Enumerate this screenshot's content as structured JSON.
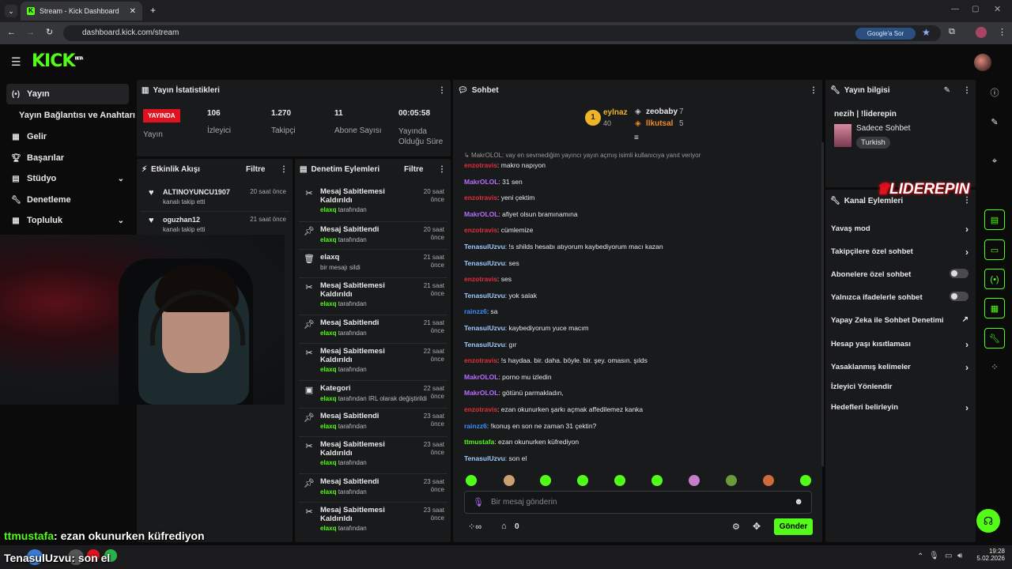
{
  "browser": {
    "tab_title": "Stream - Kick Dashboard",
    "url": "dashboard.kick.com/stream",
    "google_btn": "Google'a Sor"
  },
  "brand": {
    "logo": "KICK",
    "beta": "BETA",
    "accent": "#53fc18"
  },
  "sidebar": {
    "items": [
      {
        "label": "Yayın",
        "icon": "broadcast-icon"
      },
      {
        "label": "Yayın Bağlantısı ve Anahtarı",
        "icon": ""
      },
      {
        "label": "Gelir",
        "icon": "dollar-icon"
      },
      {
        "label": "Başarılar",
        "icon": "trophy-icon"
      },
      {
        "label": "Stüdyo",
        "icon": "studio-icon"
      },
      {
        "label": "Denetleme",
        "icon": "wrench-icon"
      },
      {
        "label": "Topluluk",
        "icon": "community-icon"
      }
    ]
  },
  "stats": {
    "title": "Yayın İstatistikleri",
    "live": "YAYINDA",
    "live_label": "Yayın",
    "items": [
      {
        "value": "106",
        "label": "İzleyici"
      },
      {
        "value": "1.270",
        "label": "Takipçi"
      },
      {
        "value": "11",
        "label": "Abone Sayısı"
      },
      {
        "value": "00:05:58",
        "label": "Yayında Olduğu Süre"
      }
    ]
  },
  "activity": {
    "title": "Etkinlik Akışı",
    "filter": "Filtre",
    "items": [
      {
        "name": "ALTINOYUNCU1907",
        "sub": "kanalı takip etti",
        "time": "20 saat önce"
      },
      {
        "name": "oguzhan12",
        "sub": "kanalı takip etti",
        "time": "21 saat önce"
      }
    ]
  },
  "moderation": {
    "title": "Denetim Eylemleri",
    "filter": "Filtre",
    "items": [
      {
        "icon": "unpin-icon",
        "name": "Mesaj Sabitlemesi Kaldırıldı",
        "user": "elaxq",
        "sub": "tarafından",
        "time": "20 saat önce"
      },
      {
        "icon": "pin-icon",
        "name": "Mesaj Sabitlendi",
        "user": "elaxq",
        "sub": "tarafından",
        "time": "20 saat önce"
      },
      {
        "icon": "trash-icon",
        "name": "elaxq",
        "user": "",
        "sub": "bir mesajı sildi",
        "time": "21 saat önce"
      },
      {
        "icon": "unpin-icon",
        "name": "Mesaj Sabitlemesi Kaldırıldı",
        "user": "elaxq",
        "sub": "tarafından",
        "time": "21 saat önce"
      },
      {
        "icon": "pin-icon",
        "name": "Mesaj Sabitlendi",
        "user": "elaxq",
        "sub": "tarafından",
        "time": "21 saat önce"
      },
      {
        "icon": "unpin-icon",
        "name": "Mesaj Sabitlemesi Kaldırıldı",
        "user": "elaxq",
        "sub": "tarafından",
        "time": "22 saat önce"
      },
      {
        "icon": "category-icon",
        "name": "Kategori",
        "user": "elaxq",
        "sub": "tarafından IRL olarak değiştirildi",
        "time": "22 saat önce"
      },
      {
        "icon": "pin-icon",
        "name": "Mesaj Sabitlendi",
        "user": "elaxq",
        "sub": "tarafından",
        "time": "23 saat önce"
      },
      {
        "icon": "unpin-icon",
        "name": "Mesaj Sabitlemesi Kaldırıldı",
        "user": "elaxq",
        "sub": "tarafından",
        "time": "23 saat önce"
      },
      {
        "icon": "pin-icon",
        "name": "Mesaj Sabitlendi",
        "user": "elaxq",
        "sub": "tarafından",
        "time": "23 saat önce"
      },
      {
        "icon": "unpin-icon",
        "name": "Mesaj Sabitlemesi Kaldırıldı",
        "user": "elaxq",
        "sub": "tarafından",
        "time": "23 saat önce"
      }
    ]
  },
  "chat": {
    "title": "Sohbet",
    "top": [
      {
        "rank": "1",
        "name": "eylnaz",
        "count": "40"
      },
      {
        "name": "zeobaby",
        "count": "7"
      },
      {
        "name": "llkutsal",
        "count": "5"
      }
    ],
    "reply": "MakrOLOL: vay en sevmediğim yayıncı yayın açmış isimli kullanıcıya yanıt veriyor",
    "messages": [
      {
        "user": "enzotravis",
        "color": "#e0303b",
        "text": ": makro napıyon"
      },
      {
        "user": "MakrOLOL",
        "color": "#b86bff",
        "text": ": 31 sen"
      },
      {
        "user": "enzotravis",
        "color": "#e0303b",
        "text": ": yeni çektim"
      },
      {
        "user": "MakrOLOL",
        "color": "#b86bff",
        "text": ": afiyet olsun bramınamına"
      },
      {
        "user": "enzotravis",
        "color": "#e0303b",
        "text": ": cümlemize"
      },
      {
        "user": "TenasulUzvu",
        "color": "#9ec9ff",
        "text": ": !s shilds hesabı atıyorum kaybediyorum macı kazan"
      },
      {
        "user": "TenasulUzvu",
        "color": "#9ec9ff",
        "text": ": ses"
      },
      {
        "user": "enzotravis",
        "color": "#e0303b",
        "text": ": ses"
      },
      {
        "user": "TenasulUzvu",
        "color": "#9ec9ff",
        "text": ": yok salak"
      },
      {
        "user": "rainzz6",
        "color": "#3b8eff",
        "text": ": sa"
      },
      {
        "user": "TenasulUzvu",
        "color": "#9ec9ff",
        "text": ": kaybediyorum yuce macım"
      },
      {
        "user": "TenasulUzvu",
        "color": "#9ec9ff",
        "text": ": gır"
      },
      {
        "user": "enzotravis",
        "color": "#e0303b",
        "text": ": !s haydaa. bir. daha. böyle. bir. şey. omasın. şılds"
      },
      {
        "user": "MakrOLOL",
        "color": "#b86bff",
        "text": ": porno mu izledin"
      },
      {
        "user": "MakrOLOL",
        "color": "#b86bff",
        "text": ": götünü parmakladın,"
      },
      {
        "user": "enzotravis",
        "color": "#e0303b",
        "text": ": ezan okunurken şarkı açmak affedilemez kanka"
      },
      {
        "user": "rainzz6",
        "color": "#3b8eff",
        "text": ": !konuş en son ne zaman 31 çektin?"
      },
      {
        "user": "ttmustafa",
        "color": "#53fc18",
        "text": ": ezan okunurken küfrediyon"
      },
      {
        "user": "TenasulUzvu",
        "color": "#9ec9ff",
        "text": ": son el"
      }
    ],
    "placeholder": "Bir mesaj gönderin",
    "count": "0",
    "send": "Gönder"
  },
  "info": {
    "title": "Yayın bilgisi",
    "stream_title": "nezih | !liderepin",
    "category": "Sadece Sohbet",
    "tag": "Turkish"
  },
  "watermark": "LIDEREPIN",
  "channel": {
    "title": "Kanal Eylemleri",
    "actions": [
      {
        "label": "Yavaş mod",
        "type": "arrow"
      },
      {
        "label": "Takipçilere özel sohbet",
        "type": "arrow"
      },
      {
        "label": "Abonelere özel sohbet",
        "type": "toggle"
      },
      {
        "label": "Yalnızca ifadelerle sohbet",
        "type": "toggle"
      },
      {
        "label": "Yapay Zeka ile Sohbet Denetimi",
        "type": "link"
      },
      {
        "label": "Hesap yaşı kısıtlaması",
        "type": "arrow"
      },
      {
        "label": "Yasaklanmış kelimeler",
        "type": "arrow"
      },
      {
        "label": "İzleyici Yönlendir",
        "type": "none"
      },
      {
        "label": "Hedefleri belirleyin",
        "type": "arrow"
      }
    ]
  },
  "overlay": {
    "line1_user": "ttmustafa",
    "line1_text": ": ezan okunurken küfrediyon",
    "line2_user": "TenasulUzvu",
    "line2_text": ": son el"
  },
  "taskbar": {
    "time": "19:28",
    "date": "5.02.2026"
  }
}
